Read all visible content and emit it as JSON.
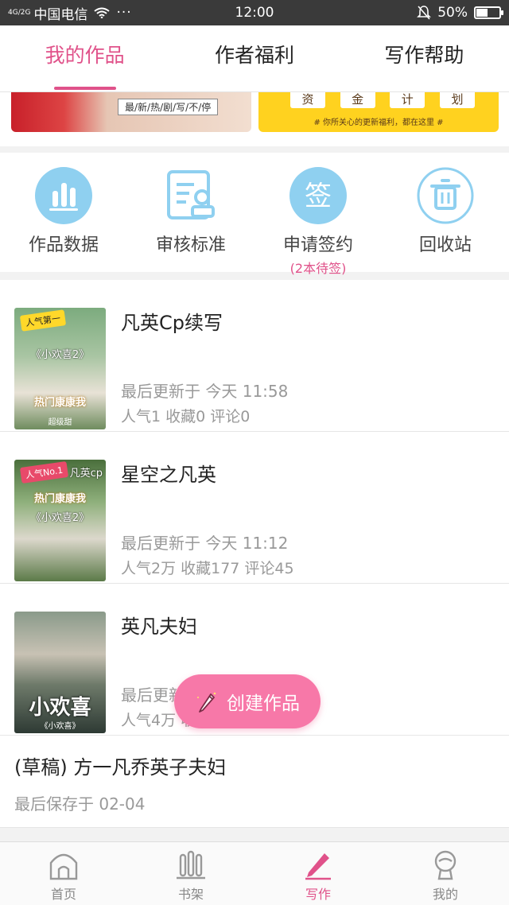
{
  "status_bar": {
    "signal": "4G/2G",
    "carrier": "中国电信",
    "menu_dots": "···",
    "time": "12:00",
    "battery": "50%",
    "battery_level": 0.5
  },
  "tabs": [
    {
      "label": "我的作品",
      "active": true
    },
    {
      "label": "作者福利",
      "active": false
    },
    {
      "label": "写作帮助",
      "active": false
    }
  ],
  "banners": {
    "left_tag": "最/新/热/剧/写/不/停",
    "right_chars": [
      "资",
      "金",
      "计",
      "划"
    ],
    "right_note": "# 你所关心的更新福利，都在这里 #"
  },
  "actions": [
    {
      "label": "作品数据",
      "icon": "bar-chart-icon",
      "sub": ""
    },
    {
      "label": "审核标准",
      "icon": "document-stamp-icon",
      "sub": ""
    },
    {
      "label": "申请签约",
      "icon": "sign-icon",
      "sub": "(2本待签)",
      "icon_text": "签"
    },
    {
      "label": "回收站",
      "icon": "trash-icon",
      "sub": ""
    }
  ],
  "works": [
    {
      "title": "凡英Cp续写",
      "updated": "最后更新于 今天 11:58",
      "stats": "人气1 收藏0 评论0",
      "cover": {
        "badge": "人气第一",
        "text": "《小欢喜2》",
        "tag": "热门康康我",
        "bottom": "超级甜 "
      }
    },
    {
      "title": "星空之凡英",
      "updated": "最后更新于 今天 11:12",
      "stats": "人气2万 收藏177 评论45",
      "cover": {
        "badge": "人气No.1",
        "text": "《小欢喜2》",
        "tag": "热门康康我",
        "corner": "凡英cp"
      }
    },
    {
      "title": "英凡夫妇",
      "updated": "最后更新于 今天",
      "stats": "人气4万 收藏 评论3",
      "cover": {
        "big": "小欢喜",
        "small": "《小欢喜》"
      }
    }
  ],
  "draft": {
    "title": "(草稿) 方一凡乔英子夫妇",
    "saved": "最后保存于 02-04"
  },
  "fab": {
    "label": "创建作品",
    "icon": "pencil-icon"
  },
  "bottom_nav": [
    {
      "label": "首页",
      "icon": "home-icon",
      "active": false
    },
    {
      "label": "书架",
      "icon": "bookshelf-icon",
      "active": false
    },
    {
      "label": "写作",
      "icon": "pencil-icon",
      "active": true
    },
    {
      "label": "我的",
      "icon": "profile-icon",
      "active": false
    }
  ],
  "colors": {
    "accent": "#e0528a",
    "fab": "#f778a8",
    "icon_blue": "#8fd0f0",
    "banner_yellow": "#ffd21f"
  }
}
